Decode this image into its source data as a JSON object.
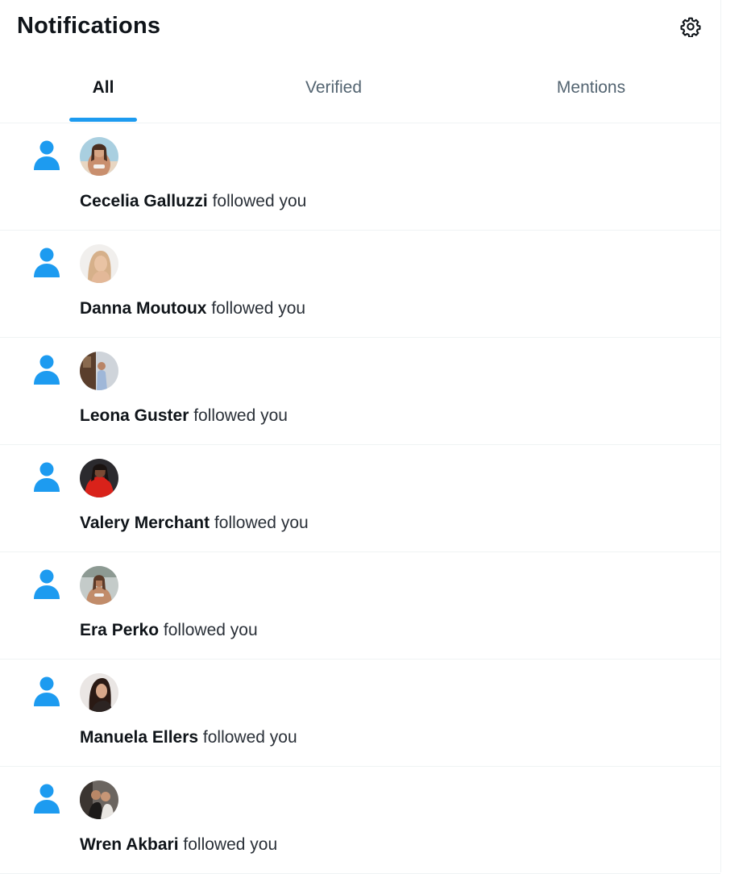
{
  "header": {
    "title": "Notifications",
    "settings_icon": "gear-icon"
  },
  "tabs": [
    {
      "label": "All",
      "active": true
    },
    {
      "label": "Verified",
      "active": false
    },
    {
      "label": "Mentions",
      "active": false
    }
  ],
  "notifications": [
    {
      "name": "Cecelia Galluzzi",
      "action": "followed you",
      "icon": "person-icon"
    },
    {
      "name": "Danna Moutoux",
      "action": "followed you",
      "icon": "person-icon"
    },
    {
      "name": "Leona Guster",
      "action": "followed you",
      "icon": "person-icon"
    },
    {
      "name": "Valery Merchant",
      "action": "followed you",
      "icon": "person-icon"
    },
    {
      "name": "Era Perko",
      "action": "followed you",
      "icon": "person-icon"
    },
    {
      "name": "Manuela Ellers",
      "action": "followed you",
      "icon": "person-icon"
    },
    {
      "name": "Wren Akbari",
      "action": "followed you",
      "icon": "person-icon"
    }
  ],
  "colors": {
    "accent": "#1d9bf0",
    "text_primary": "#0f1419",
    "text_secondary": "#536471",
    "divider": "#eff3f4"
  }
}
